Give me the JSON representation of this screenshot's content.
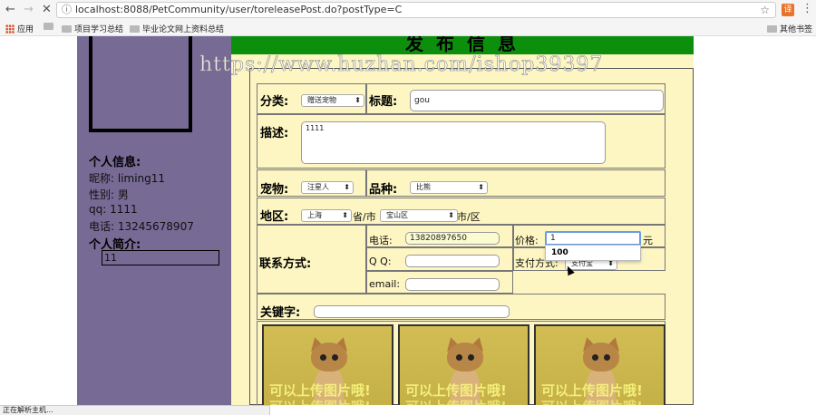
{
  "browser": {
    "url": "localhost:8088/PetCommunity/user/toreleasePost.do?postType=C",
    "bookmarks": [
      {
        "label": "应用"
      },
      {
        "label": ""
      },
      {
        "label": "项目学习总结"
      },
      {
        "label": "毕业论文网上资料总结"
      }
    ],
    "other_bookmarks": "其他书签",
    "status": "正在解析主机..."
  },
  "sidebar": {
    "info_title": "个人信息:",
    "nickname": "昵称:   liming11",
    "gender": "性别:   男",
    "qq": "qq:     1111",
    "phone": "电话:   13245678907",
    "intro_title": "个人简介:",
    "intro_value": "11"
  },
  "main": {
    "header_title": "发布信息",
    "watermark": "https://www.huzhan.com/ishop39397",
    "category_label": "分类:",
    "category_value": "赠送宠物",
    "title_label": "标题:",
    "title_value": "gou",
    "desc_label": "描述:",
    "desc_value": "1111",
    "pet_label": "宠物:",
    "pet_value": "汪星人",
    "breed_label": "品种:",
    "breed_value": "比熊",
    "region_label": "地区:",
    "province_value": "上海",
    "province_suffix": "省/市",
    "district_value": "宝山区",
    "district_suffix": "市/区",
    "contact_label": "联系方式:",
    "phone_label": "电话:",
    "phone_value": "13820897650",
    "qq_label": "Q Q:",
    "qq_value": "",
    "email_label": "email:",
    "email_value": "",
    "price_label": "价格:",
    "price_value": "1",
    "price_unit": "元",
    "price_suggestion": "100",
    "payment_label": "支付方式:",
    "payment_value": "支付宝",
    "keyword_label": "关键字:",
    "keyword_value": "",
    "photo_caption": "可以上传图片哦!",
    "photo_caption_2": "可以上传图片哦!"
  }
}
